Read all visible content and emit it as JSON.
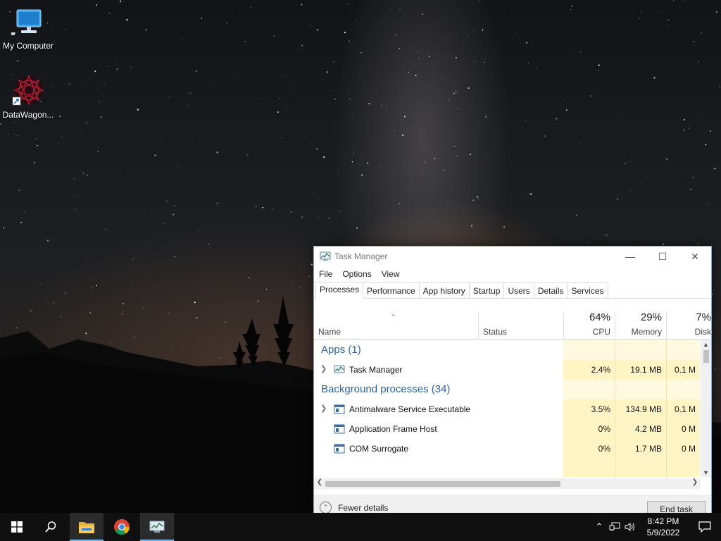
{
  "desktop": {
    "icons": [
      {
        "label": "My Computer"
      },
      {
        "label": "DataWagon..."
      }
    ]
  },
  "task_manager": {
    "title": "Task Manager",
    "menu": [
      "File",
      "Options",
      "View"
    ],
    "tabs": [
      "Processes",
      "Performance",
      "App history",
      "Startup",
      "Users",
      "Details",
      "Services"
    ],
    "active_tab": "Processes",
    "columns": {
      "name": "Name",
      "status": "Status",
      "cpu": {
        "percent": "64%",
        "label": "CPU"
      },
      "memory": {
        "percent": "29%",
        "label": "Memory"
      },
      "disk": {
        "percent": "7%",
        "label": "Disk"
      }
    },
    "groups": {
      "apps": "Apps (1)",
      "background": "Background processes (34)"
    },
    "rows": [
      {
        "name": "Task Manager",
        "cpu": "2.4%",
        "memory": "19.1 MB",
        "disk": "0.1 M"
      },
      {
        "name": "Antimalware Service Executable",
        "cpu": "3.5%",
        "memory": "134.9 MB",
        "disk": "0.1 M"
      },
      {
        "name": "Application Frame Host",
        "cpu": "0%",
        "memory": "4.2 MB",
        "disk": "0 M"
      },
      {
        "name": "COM Surrogate",
        "cpu": "0%",
        "memory": "1.7 MB",
        "disk": "0 M"
      }
    ],
    "footer": {
      "fewer_details": "Fewer details",
      "end_task": "End task"
    }
  },
  "taskbar": {
    "clock": {
      "time": "8:42 PM",
      "date": "5/9/2022"
    }
  },
  "colors": {
    "accent": "#2a63b8",
    "heat": "#fff4c4",
    "taskbar": "#101010"
  }
}
